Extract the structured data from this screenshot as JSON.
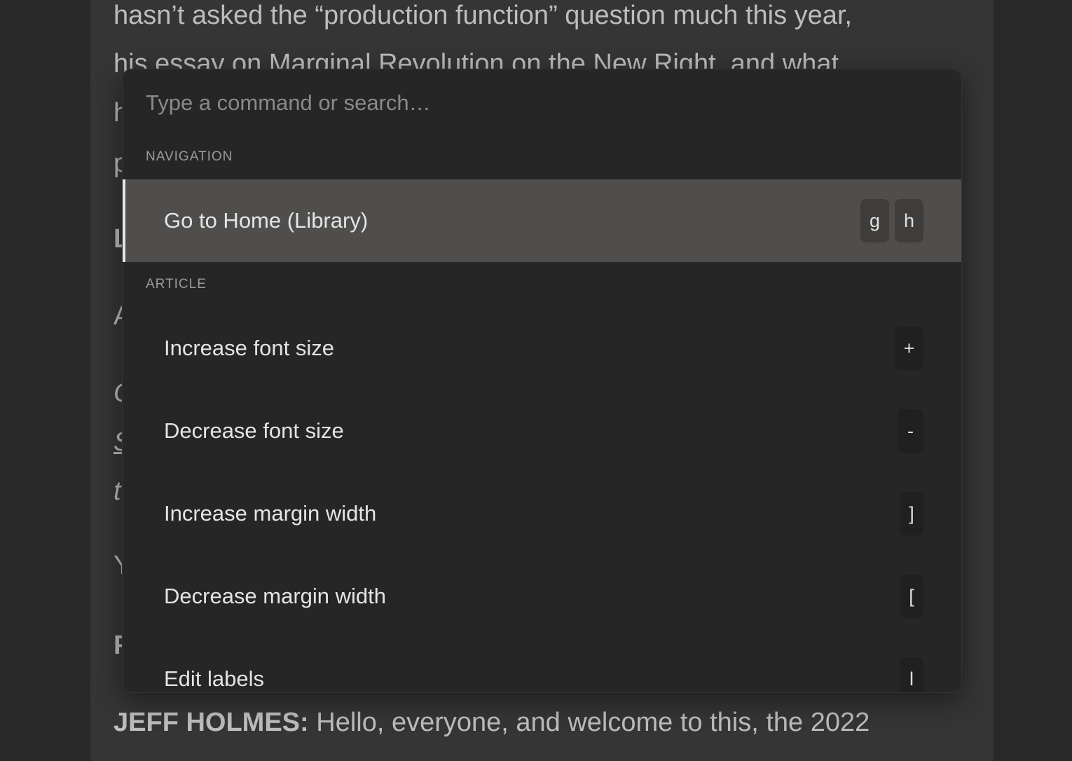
{
  "article": {
    "lines": [
      "hasn’t asked the “production function” question much this year,",
      "his essay on Marginal Revolution on the New Right, and what"
    ],
    "fragments": [
      "h",
      "p",
      "L",
      "A",
      "C",
      "S",
      "t",
      "Y",
      "F"
    ],
    "speaker": "JEFF HOLMES:",
    "speech": " Hello, everyone, and welcome to this, the 2022"
  },
  "palette": {
    "search": {
      "placeholder": "Type a command or search…",
      "value": ""
    },
    "sections": [
      {
        "label": "NAVIGATION",
        "commands": [
          {
            "label": "Go to Home (Library)",
            "keys": [
              "g",
              "h"
            ],
            "active": true
          }
        ]
      },
      {
        "label": "ARTICLE",
        "commands": [
          {
            "label": "Increase font size",
            "keys": [
              "+"
            ]
          },
          {
            "label": "Decrease font size",
            "keys": [
              "-"
            ]
          },
          {
            "label": "Increase margin width",
            "keys": [
              "]"
            ]
          },
          {
            "label": "Decrease margin width",
            "keys": [
              "["
            ]
          },
          {
            "label": "Edit labels",
            "keys": [
              "l"
            ]
          }
        ]
      }
    ]
  }
}
